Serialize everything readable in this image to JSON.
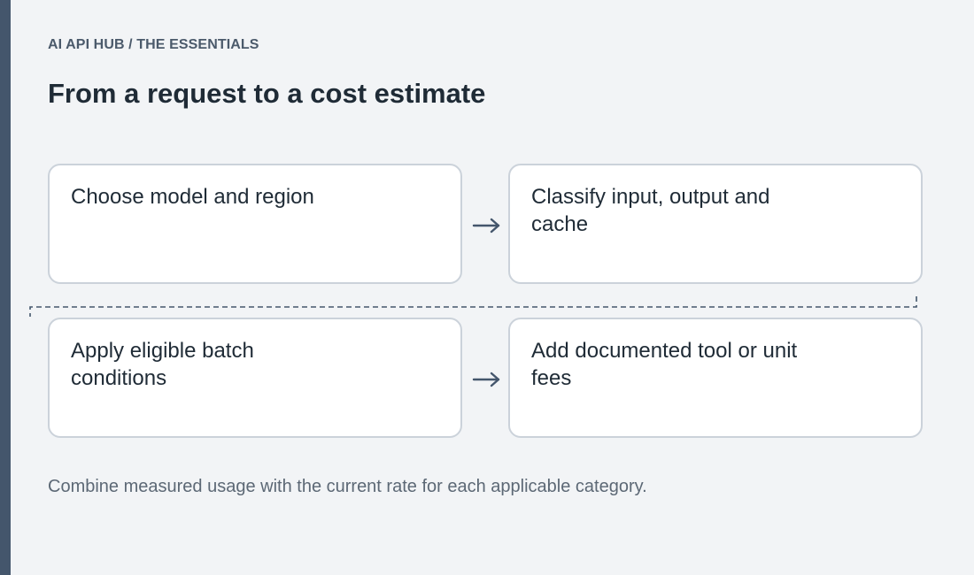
{
  "header": {
    "breadcrumb": "AI API HUB / THE ESSENTIALS",
    "title": "From a request to a cost estimate"
  },
  "steps": [
    {
      "label": "Choose model and region"
    },
    {
      "label": "Classify input, output and cache"
    },
    {
      "label": "Apply eligible batch conditions"
    },
    {
      "label": "Add documented tool or unit fees"
    }
  ],
  "caption": "Combine measured usage with the current rate for each applicable category.",
  "colors": {
    "accent_bar": "#44566c",
    "background": "#f2f4f6",
    "card_border": "#cbd2da",
    "arrow": "#44566c",
    "connector": "#44566c"
  },
  "icons": {
    "step_arrow": "right-arrow-icon",
    "row_connector": "dashed-connector"
  }
}
